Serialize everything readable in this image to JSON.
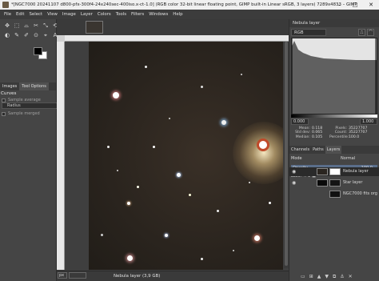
{
  "window": {
    "title": "*[NGC7000 20241107 d800-pfx-300f4-24x240sec-400iso.x-ct-1.0] (RGB color 32-bit linear floating point, GIMP built-in Linear sRGB, 3 layers) 7289x4833 – GIMP",
    "controls": [
      "–",
      "□",
      "✕"
    ]
  },
  "menu": [
    "File",
    "Edit",
    "Select",
    "View",
    "Image",
    "Layer",
    "Colors",
    "Tools",
    "Filters",
    "Windows",
    "Help"
  ],
  "toolbox": {
    "tools": [
      "✥",
      "⬚",
      "⌓",
      "✂",
      "⤡",
      "⟲",
      "◐",
      "✎",
      "✐",
      "⊙",
      "⌖",
      "A"
    ],
    "fg_color": "#000000",
    "bg_color": "#ffffff"
  },
  "left_dock": {
    "tabs": [
      "Images",
      "Tool Options"
    ],
    "title": "Curves",
    "sample_average": "Sample average",
    "radius_label": "Radius",
    "radius_value": "3",
    "sample_merged": "Sample merged"
  },
  "canvas": {
    "statusbar_unit": "px",
    "zoom": "",
    "status_text": "Nebula layer (3,9 GB)"
  },
  "histogram": {
    "tab": "Nebula layer",
    "channel": "RGB",
    "range_min": "0.000",
    "range_max": "1.000",
    "stats": [
      {
        "k": "Mean:",
        "v": "0.118",
        "k2": "Pixels:",
        "v2": "35227707"
      },
      {
        "k": "Std dev:",
        "v": "0.065",
        "k2": "Count:",
        "v2": "35227707"
      },
      {
        "k": "Median:",
        "v": "0.105",
        "k2": "Percentile:",
        "v2": "100.0"
      }
    ]
  },
  "layers": {
    "tabs": [
      "Channels",
      "Paths",
      "Layers"
    ],
    "mode_label": "Mode",
    "mode_value": "Normal",
    "opacity_label": "Opacity",
    "opacity_value": "100.0",
    "lock_label": "Lock:",
    "items": [
      {
        "name": "Nebula layer",
        "visible": true,
        "selected": true
      },
      {
        "name": "Star layer",
        "visible": true,
        "selected": false
      },
      {
        "name": "NGC7000 fits org",
        "visible": false,
        "selected": false
      }
    ]
  }
}
